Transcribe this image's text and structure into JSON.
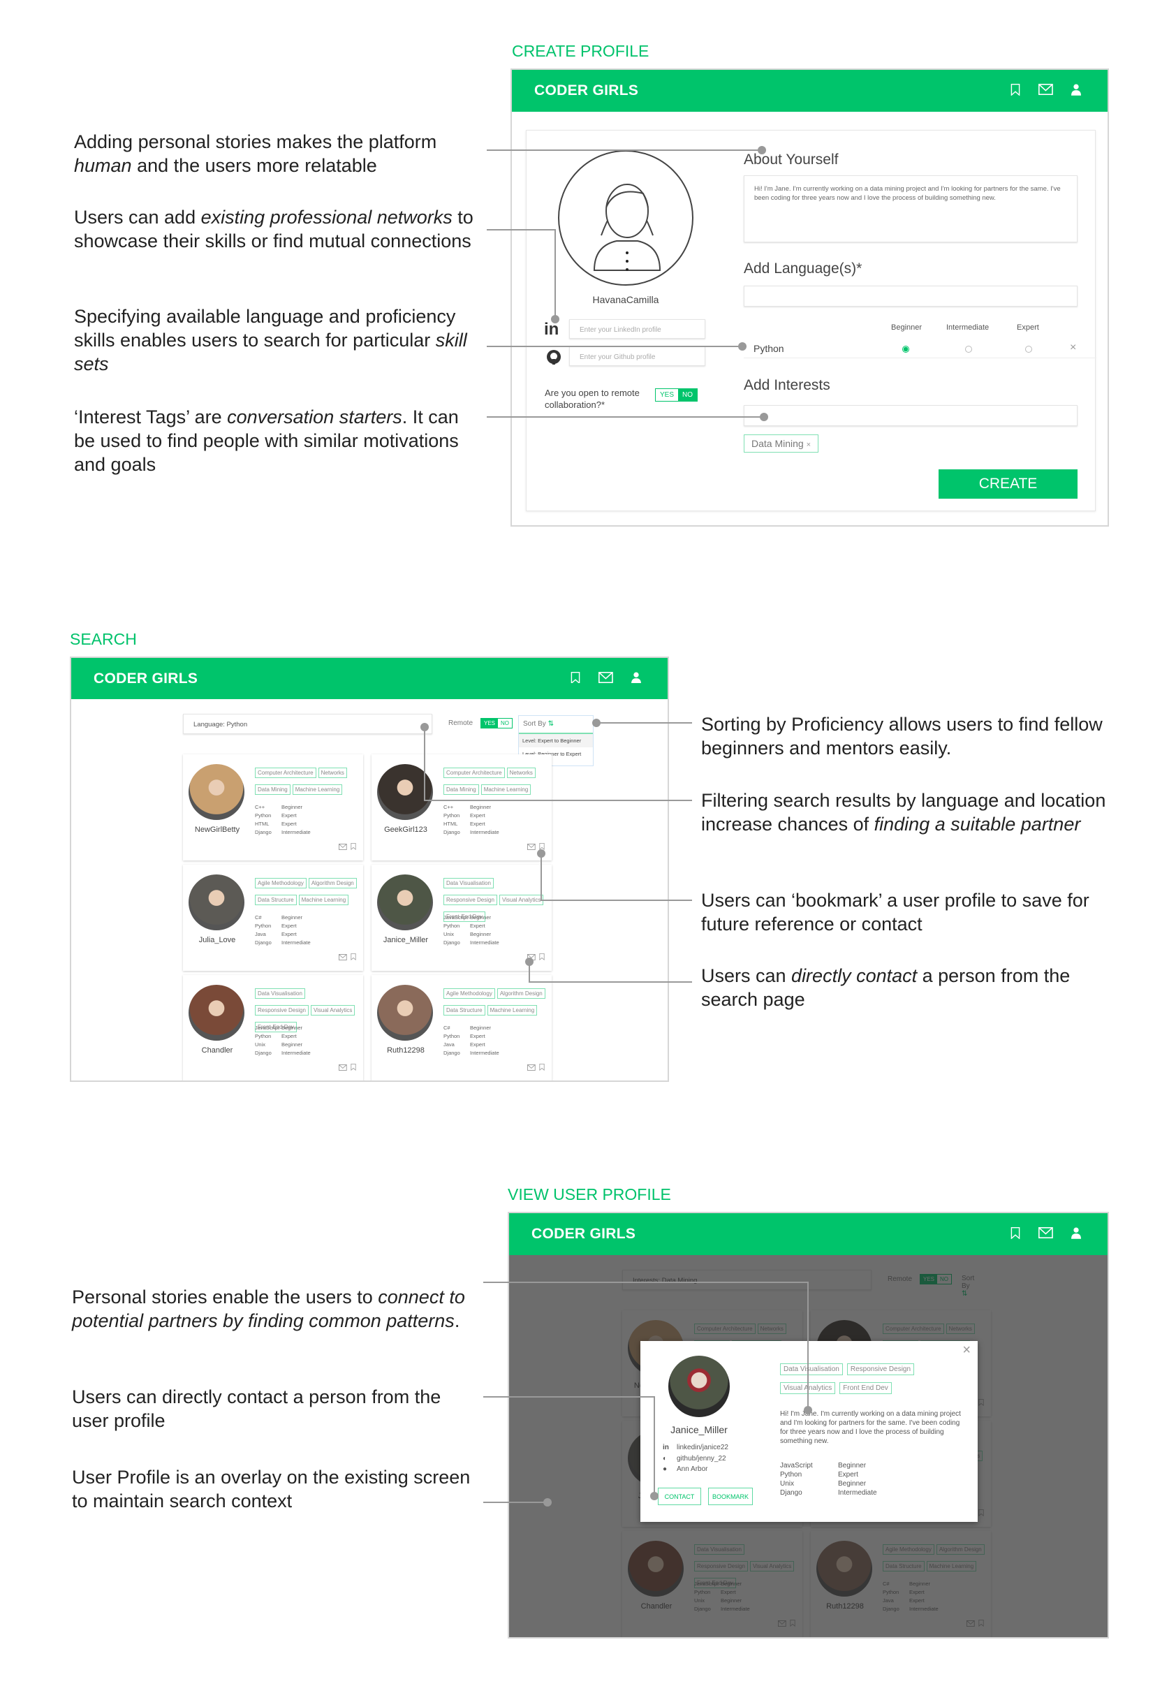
{
  "brand_color": "#00c46b",
  "app_name": "CODER GIRLS",
  "header_icons": [
    "bookmark-icon",
    "mail-icon",
    "user-icon"
  ],
  "create_profile": {
    "section_label": "CREATE PROFILE",
    "username": "HavanaCamilla",
    "linkedin_placeholder": "Enter your LinkedIn profile",
    "github_placeholder": "Enter your Github profile",
    "remote_question": "Are you open to remote collaboration?*",
    "toggle_yes": "YES",
    "toggle_no": "NO",
    "about_label": "About Yourself",
    "about_text": "Hi! I'm Jane. I'm currently working on a data mining project and I'm looking for partners for the same. I've been coding for three years now and I love the process of building something new.",
    "languages_label": "Add Language(s)*",
    "levels": [
      "Beginner",
      "Intermediate",
      "Expert"
    ],
    "language": "Python",
    "language_level": "Beginner",
    "interests_label": "Add Interests",
    "interest_tag": "Data Mining",
    "create_label": "CREATE",
    "annotations": [
      {
        "pre": "Adding personal stories makes the platform ",
        "em": "human",
        "post": " and the users more relatable"
      },
      {
        "pre": "Users can add ",
        "em": "existing professional networks",
        "post": " to showcase their skills or find mutual connections"
      },
      {
        "pre": "Specifying available language and proficiency skills enables users to search for particular ",
        "em": "skill sets",
        "post": ""
      },
      {
        "pre": "‘Interest Tags’ are ",
        "em": "conversation starters",
        "post": ". It can be used to find people with similar motivations and goals"
      }
    ]
  },
  "search": {
    "section_label": "SEARCH",
    "query": "Language: Python",
    "remote_label": "Remote",
    "sort_label": "Sort By",
    "sort_options": [
      "Level: Expert to Beginner",
      "Level: Beginner to Expert"
    ],
    "annotations": [
      {
        "pre": "Sorting by Proficiency allows users to find fellow beginners and mentors easily.",
        "em": "",
        "post": ""
      },
      {
        "pre": "Filtering search results by language and location increase chances of ",
        "em": "finding a suitable partner",
        "post": ""
      },
      {
        "pre": "Users can ‘bookmark’ a user profile to save for future reference or contact",
        "em": "",
        "post": ""
      },
      {
        "pre": "Users can ",
        "em": "directly contact",
        "post": " a person from the search page"
      }
    ]
  },
  "users": [
    {
      "name": "NewGirlBetty",
      "tags": [
        "Computer Architecture",
        "Networks",
        "Data Mining",
        "Machine Learning"
      ],
      "skills": [
        [
          "C++",
          "Beginner"
        ],
        [
          "Python",
          "Expert"
        ],
        [
          "HTML",
          "Expert"
        ],
        [
          "Django",
          "Intermediate"
        ]
      ],
      "tone": "#c9a070"
    },
    {
      "name": "GeekGirl123",
      "tags": [
        "Computer Architecture",
        "Networks",
        "Data Mining",
        "Machine Learning"
      ],
      "skills": [
        [
          "C++",
          "Beginner"
        ],
        [
          "Python",
          "Expert"
        ],
        [
          "HTML",
          "Expert"
        ],
        [
          "Django",
          "Intermediate"
        ]
      ],
      "tone": "#3a332e"
    },
    {
      "name": "Julia_Love",
      "tags": [
        "Agile Methodology",
        "Algorithm Design",
        "Data Structure",
        "Machine Learning"
      ],
      "skills": [
        [
          "C#",
          "Beginner"
        ],
        [
          "Python",
          "Expert"
        ],
        [
          "Java",
          "Expert"
        ],
        [
          "Django",
          "Intermediate"
        ]
      ],
      "tone": "#5c5a55"
    },
    {
      "name": "Janice_Miller",
      "tags": [
        "Data Visualisation",
        "Responsive Design",
        "Visual Analytics",
        "Front-End Dev"
      ],
      "skills": [
        [
          "JavaScript",
          "Beginner"
        ],
        [
          "Python",
          "Expert"
        ],
        [
          "Unix",
          "Beginner"
        ],
        [
          "Django",
          "Intermediate"
        ]
      ],
      "tone": "#4e5646"
    },
    {
      "name": "Chandler",
      "tags": [
        "Data Visualisation",
        "Responsive Design",
        "Visual Analytics",
        "Front-End Dev"
      ],
      "skills": [
        [
          "JavaScript",
          "Beginner"
        ],
        [
          "Python",
          "Expert"
        ],
        [
          "Unix",
          "Beginner"
        ],
        [
          "Django",
          "Intermediate"
        ]
      ],
      "tone": "#7a4a38"
    },
    {
      "name": "Ruth12298",
      "tags": [
        "Agile Methodology",
        "Algorithm Design",
        "Data Structure",
        "Machine Learning"
      ],
      "skills": [
        [
          "C#",
          "Beginner"
        ],
        [
          "Python",
          "Expert"
        ],
        [
          "Java",
          "Expert"
        ],
        [
          "Django",
          "Intermediate"
        ]
      ],
      "tone": "#8a6a5a"
    }
  ],
  "view_profile": {
    "section_label": "VIEW USER PROFILE",
    "query": "Interests: Data Mining",
    "remote_label": "Remote",
    "sort_label": "Sort By",
    "modal": {
      "name": "Janice_Miller",
      "linkedin": "linkedin/janice22",
      "github": "github/jenny_22",
      "location": "Ann Arbor",
      "contact_label": "CONTACT",
      "bookmark_label": "BOOKMARK",
      "tags": [
        "Data Visualisation",
        "Responsive Design",
        "Visual Analytics",
        "Front End Dev"
      ],
      "bio": "Hi! I'm Jane. I'm currently working on a data mining project and I'm looking for partners for the same. I've been coding for three years now and I love the process of building something new.",
      "skills": [
        [
          "JavaScript",
          "Beginner"
        ],
        [
          "Python",
          "Expert"
        ],
        [
          "Unix",
          "Beginner"
        ],
        [
          "Django",
          "Intermediate"
        ]
      ]
    },
    "annotations": [
      {
        "pre": "Personal stories enable the users to ",
        "em": "connect to potential partners by finding common patterns",
        "post": "."
      },
      {
        "pre": "Users can directly contact a person from the user profile",
        "em": "",
        "post": ""
      },
      {
        "pre": "User Profile is an overlay on the existing screen to maintain search context",
        "em": "",
        "post": ""
      }
    ]
  }
}
